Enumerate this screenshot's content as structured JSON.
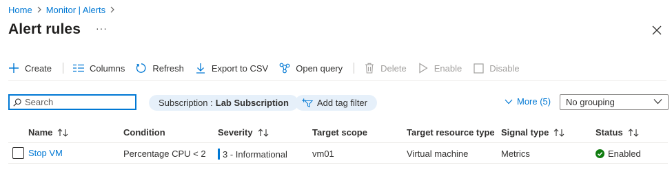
{
  "breadcrumb": {
    "items": [
      "Home",
      "Monitor | Alerts"
    ]
  },
  "page": {
    "title": "Alert rules",
    "more_label": "···"
  },
  "toolbar": {
    "create": "Create",
    "columns": "Columns",
    "refresh": "Refresh",
    "export": "Export to CSV",
    "open_query": "Open query",
    "delete": "Delete",
    "enable": "Enable",
    "disable": "Disable"
  },
  "filters": {
    "search_placeholder": "Search",
    "subscription_label": "Subscription :",
    "subscription_value": "Lab Subscription",
    "add_tag_filter": "Add tag filter",
    "more": "More (5)",
    "grouping": "No grouping"
  },
  "table": {
    "columns": [
      "Name",
      "Condition",
      "Severity",
      "Target scope",
      "Target resource type",
      "Signal type",
      "Status"
    ],
    "rows": [
      {
        "name": "Stop VM",
        "condition": "Percentage CPU < 2",
        "severity": "3 - Informational",
        "target_scope": "vm01",
        "target_resource_type": "Virtual machine",
        "signal_type": "Metrics",
        "status": "Enabled"
      }
    ]
  },
  "colors": {
    "accent": "#0078d4",
    "success": "#107c10",
    "pill_bg": "#e6f0fa"
  }
}
